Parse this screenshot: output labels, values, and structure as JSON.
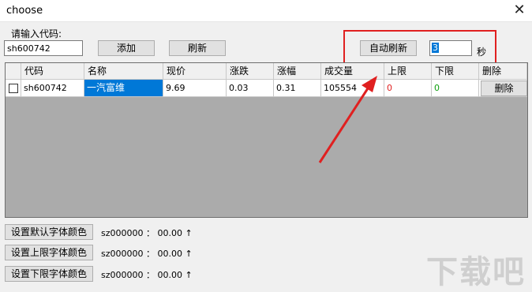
{
  "window": {
    "title": "choose",
    "close_glyph": "✕"
  },
  "form": {
    "code_label": "请输入代码:",
    "code_value": "sh600742",
    "add_label": "添加",
    "refresh_label": "刷新",
    "auto_refresh_label": "自动刷新",
    "interval_value": "3",
    "interval_unit": "秒"
  },
  "table": {
    "headers": [
      "代码",
      "名称",
      "现价",
      "涨跌",
      "涨幅",
      "成交量",
      "上限",
      "下限",
      "删除"
    ],
    "rows": [
      {
        "checked": false,
        "code": "sh600742",
        "name": "一汽富维",
        "price": "9.69",
        "change": "0.03",
        "change_pct": "0.31",
        "volume": "105554",
        "upper": "0",
        "lower": "0",
        "delete_label": "删除"
      }
    ]
  },
  "colors": {
    "upper": "#e02020",
    "lower": "#10a010",
    "highlight": "#e02020",
    "selection": "#0078d7"
  },
  "bottom": {
    "buttons": [
      {
        "label": "设置默认字体颜色"
      },
      {
        "label": "设置上限字体颜色"
      },
      {
        "label": "设置下限字体颜色"
      }
    ],
    "status": [
      "sz000000 ： 00.00 ↑",
      "sz000000 ： 00.00 ↑",
      "sz000000 ： 00.00 ↑"
    ]
  },
  "watermark": {
    "text": "下载吧"
  }
}
